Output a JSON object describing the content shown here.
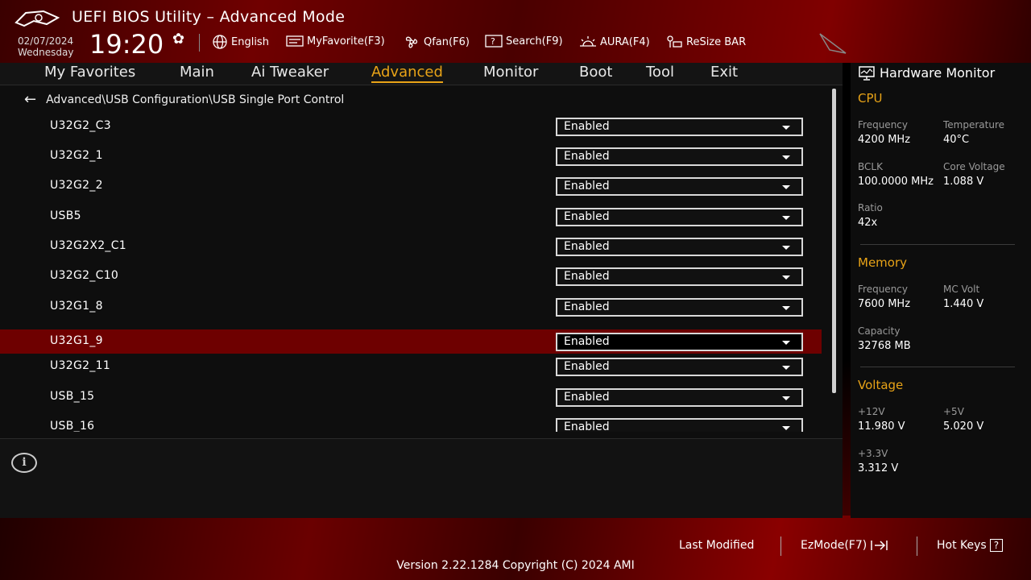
{
  "header": {
    "title": "UEFI BIOS Utility – Advanced Mode",
    "date": "02/07/2024",
    "weekday": "Wednesday",
    "time": "19:20",
    "items": [
      {
        "label": "English",
        "icon": "globe-icon"
      },
      {
        "label": "MyFavorite(F3)",
        "icon": "favorite-icon"
      },
      {
        "label": "Qfan(F6)",
        "icon": "fan-icon"
      },
      {
        "label": "Search(F9)",
        "icon": "search-icon"
      },
      {
        "label": "AURA(F4)",
        "icon": "aura-icon"
      },
      {
        "label": "ReSize BAR",
        "icon": "resize-bar-icon"
      }
    ]
  },
  "tabs": [
    "My Favorites",
    "Main",
    "Ai Tweaker",
    "Advanced",
    "Monitor",
    "Boot",
    "Tool",
    "Exit"
  ],
  "active_tab": "Advanced",
  "breadcrumb": "Advanced\\USB Configuration\\USB Single Port Control",
  "settings": [
    {
      "label": "U32G2_C3",
      "value": "Enabled"
    },
    {
      "label": "U32G2_1",
      "value": "Enabled"
    },
    {
      "label": "U32G2_2",
      "value": "Enabled"
    },
    {
      "label": "USB5",
      "value": "Enabled"
    },
    {
      "label": "U32G2X2_C1",
      "value": "Enabled"
    },
    {
      "label": "U32G2_C10",
      "value": "Enabled"
    },
    {
      "label": "U32G1_8",
      "value": "Enabled"
    },
    {
      "label": "U32G1_9",
      "value": "Enabled"
    },
    {
      "label": "U32G2_11",
      "value": "Enabled"
    },
    {
      "label": "USB_15",
      "value": "Enabled"
    },
    {
      "label": "USB_16",
      "value": "Enabled"
    }
  ],
  "selected_setting": "U32G1_9",
  "hardware_monitor": {
    "title": "Hardware Monitor",
    "cpu": {
      "heading": "CPU",
      "frequency_label": "Frequency",
      "frequency": "4200 MHz",
      "temperature_label": "Temperature",
      "temperature": "40°C",
      "bclk_label": "BCLK",
      "bclk": "100.0000 MHz",
      "core_voltage_label": "Core Voltage",
      "core_voltage": "1.088 V",
      "ratio_label": "Ratio",
      "ratio": "42x"
    },
    "memory": {
      "heading": "Memory",
      "frequency_label": "Frequency",
      "frequency": "7600 MHz",
      "mc_volt_label": "MC Volt",
      "mc_volt": "1.440 V",
      "capacity_label": "Capacity",
      "capacity": "32768 MB"
    },
    "voltage": {
      "heading": "Voltage",
      "v12_label": "+12V",
      "v12": "11.980 V",
      "v5_label": "+5V",
      "v5": "5.020 V",
      "v33_label": "+3.3V",
      "v33": "3.312 V"
    }
  },
  "footer": {
    "last_modified": "Last Modified",
    "ezmode": "EzMode(F7)",
    "hotkeys": "Hot Keys",
    "hotkeys_key": "?",
    "version": "Version 2.22.1284 Copyright (C) 2024 AMI"
  },
  "colors": {
    "accent": "#e8a317",
    "selected_row": "#6e0000",
    "brand_red": "#8b0000"
  }
}
